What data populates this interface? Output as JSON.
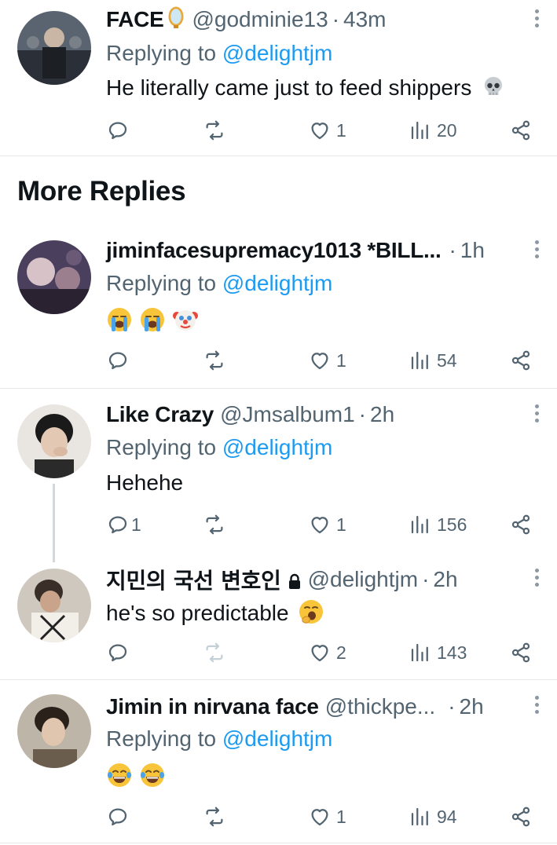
{
  "section_title": "More Replies",
  "tweets": [
    {
      "name": "FACE",
      "name_emoji": "mirror-emoji",
      "handle": "@godminie13",
      "dot": "·",
      "time": "43m",
      "replying_prefix": "Replying to",
      "replying_to": "@delightjm",
      "text": "He literally came just to feed shippers",
      "text_emoji": "skull-emoji",
      "replies": "",
      "retweets": "",
      "likes": "1",
      "views": "20"
    },
    {
      "name": "jiminfacesupremacy1013 *BILL...",
      "handle": "",
      "dot": "·",
      "time": "1h",
      "replying_prefix": "Replying to",
      "replying_to": "@delightjm",
      "text": "",
      "text_emoji": "loudly-crying-face, loudly-crying-face, clown-face",
      "replies": "",
      "retweets": "",
      "likes": "1",
      "views": "54"
    },
    {
      "name": "Like Crazy",
      "handle": "@Jmsalbum1",
      "dot": "·",
      "time": "2h",
      "replying_prefix": "Replying to",
      "replying_to": "@delightjm",
      "text": "Hehehe",
      "replies": "1",
      "retweets": "",
      "likes": "1",
      "views": "156"
    },
    {
      "name": "지민의 국선 변호인",
      "protected_icon": "lock-icon",
      "handle": "@delightjm",
      "dot": "·",
      "time": "2h",
      "text": "he's so predictable",
      "text_emoji": "yawning-face",
      "replies": "",
      "retweets": "",
      "likes": "2",
      "views": "143"
    },
    {
      "name": "Jimin in nirvana face",
      "handle": "@thickpe...",
      "dot": "·",
      "time": "2h",
      "replying_prefix": "Replying to",
      "replying_to": "@delightjm",
      "text": "",
      "text_emoji": "face-with-tears-of-joy, face-with-tears-of-joy",
      "replies": "",
      "retweets": "",
      "likes": "1",
      "views": "94"
    }
  ],
  "colors": {
    "text": "#0f1419",
    "secondary": "#536471",
    "link": "#1d9bf0",
    "divider": "#e6e9ec",
    "thread_line": "#cfd9de"
  },
  "icons": {
    "reply": "reply-icon",
    "retweet": "retweet-icon",
    "like": "heart-icon",
    "views": "views-icon",
    "share": "share-icon",
    "more": "more-icon"
  }
}
